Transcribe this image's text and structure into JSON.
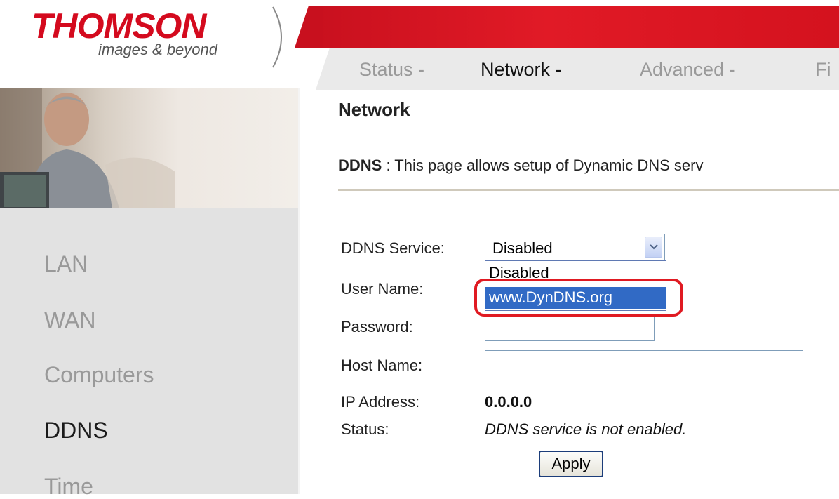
{
  "brand": {
    "name": "THOMSON",
    "tagline": "images & beyond",
    "color": "#d40a1e"
  },
  "topnav": {
    "items": [
      {
        "label": "Status -",
        "active": false
      },
      {
        "label": "Network -",
        "active": true
      },
      {
        "label": "Advanced -",
        "active": false
      },
      {
        "label": "Fi",
        "active": false
      }
    ]
  },
  "sidebar": {
    "items": [
      {
        "label": "LAN",
        "active": false
      },
      {
        "label": "WAN",
        "active": false
      },
      {
        "label": "Computers",
        "active": false
      },
      {
        "label": "DDNS",
        "active": true
      },
      {
        "label": "Time",
        "active": false
      }
    ]
  },
  "main": {
    "title": "Network",
    "desc_key": "DDNS",
    "desc_sep": " : ",
    "desc_text": "This page allows setup of Dynamic DNS serv",
    "form": {
      "service_label": "DDNS Service:",
      "service_value": "Disabled",
      "service_options": [
        "Disabled",
        "www.DynDNS.org"
      ],
      "service_highlighted": "www.DynDNS.org",
      "user_label": "User Name:",
      "user_value": "",
      "password_label": "Password:",
      "password_value": "",
      "host_label": "Host Name:",
      "host_value": "",
      "ip_label": "IP Address:",
      "ip_value": "0.0.0.0",
      "status_label": "Status:",
      "status_value": "DDNS service is not enabled.",
      "apply_label": "Apply"
    }
  },
  "colors": {
    "accent_red": "#e11a26",
    "highlight_ring": "#e01a22",
    "selection_blue": "#316ac5"
  }
}
